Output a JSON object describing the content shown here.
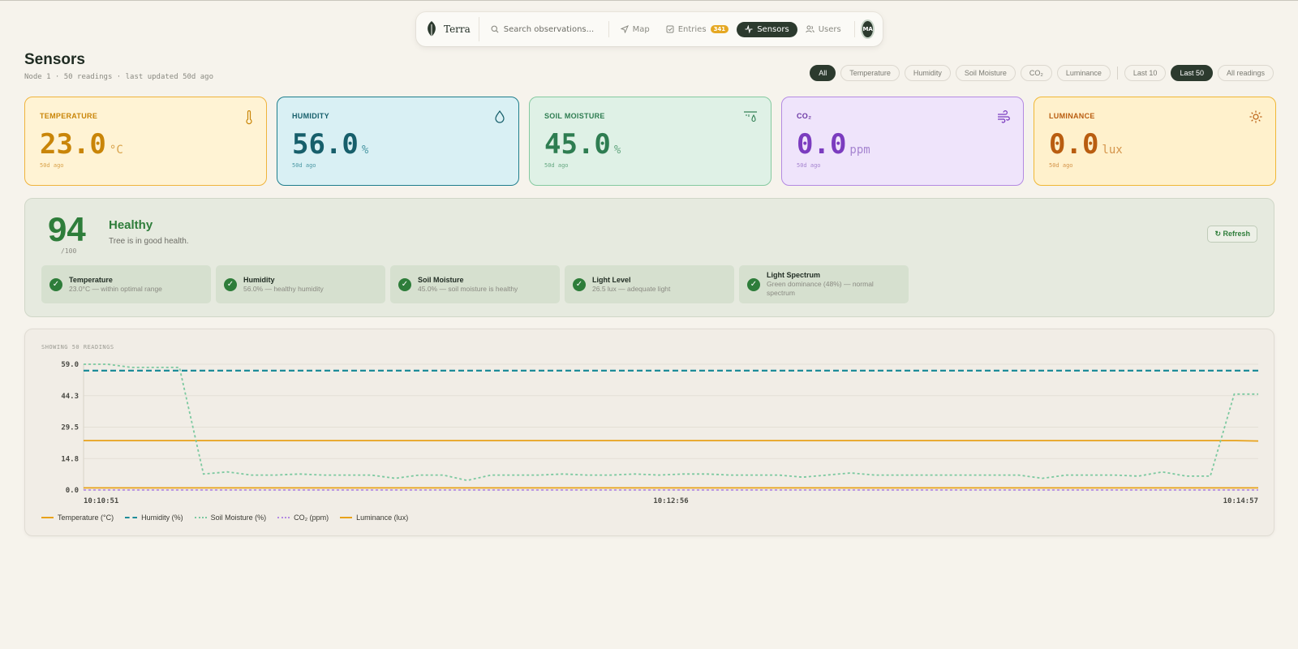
{
  "nav": {
    "brand": "Terra",
    "search_placeholder": "Search observations...",
    "items": [
      {
        "label": "Map",
        "icon": "send-icon"
      },
      {
        "label": "Entries",
        "icon": "checkbox-icon",
        "badge": "341"
      },
      {
        "label": "Sensors",
        "icon": "activity-icon",
        "active": true
      },
      {
        "label": "Users",
        "icon": "users-icon"
      }
    ],
    "avatar": "MA"
  },
  "header": {
    "title": "Sensors",
    "subtitle": "Node 1 · 50 readings · last updated 50d ago"
  },
  "filters": {
    "types": [
      "All",
      "Temperature",
      "Humidity",
      "Soil Moisture",
      "CO₂",
      "Luminance"
    ],
    "ranges": [
      "Last 10",
      "Last 50",
      "All readings"
    ],
    "active_type": "All",
    "active_range": "Last 50"
  },
  "cards": [
    {
      "label": "TEMPERATURE",
      "value": "23.0",
      "unit": "°C",
      "ago": "50d ago",
      "icon": "thermometer-icon"
    },
    {
      "label": "HUMIDITY",
      "value": "56.0",
      "unit": "%",
      "ago": "50d ago",
      "icon": "droplet-icon"
    },
    {
      "label": "SOIL MOISTURE",
      "value": "45.0",
      "unit": "%",
      "ago": "50d ago",
      "icon": "sprinkler-icon"
    },
    {
      "label": "CO₂",
      "value": "0.0",
      "unit": "ppm",
      "ago": "50d ago",
      "icon": "wind-icon"
    },
    {
      "label": "LUMINANCE",
      "value": "0.0",
      "unit": "lux",
      "ago": "50d ago",
      "icon": "sun-icon"
    }
  ],
  "health": {
    "score": "94",
    "max": "/100",
    "status": "Healthy",
    "description": "Tree is in good health.",
    "refresh_label": "↻ Refresh",
    "checks": [
      {
        "title": "Temperature",
        "desc": "23.0°C — within optimal range"
      },
      {
        "title": "Humidity",
        "desc": "56.0% — healthy humidity"
      },
      {
        "title": "Soil Moisture",
        "desc": "45.0% — soil moisture is healthy"
      },
      {
        "title": "Light Level",
        "desc": "26.5 lux — adequate light"
      },
      {
        "title": "Light Spectrum",
        "desc": "Green dominance (48%) — normal spectrum"
      }
    ]
  },
  "chart_caption": "SHOWING 50 READINGS",
  "chart_data": {
    "type": "line",
    "ylim": [
      0.0,
      59.0
    ],
    "yticks": [
      "59.0",
      "44.3",
      "29.5",
      "14.8",
      "0.0"
    ],
    "xticks": [
      "10:10:51",
      "10:12:56",
      "10:14:57"
    ],
    "grid": true,
    "legend": "bottom-left",
    "series": [
      {
        "name": "Temperature (°C)",
        "color": "#e8a21a",
        "dash": "solid",
        "values": [
          23.2,
          23.2,
          23.2,
          23.2,
          23.2,
          23.2,
          23.2,
          23.2,
          23.2,
          23.2,
          23.2,
          23.2,
          23.2,
          23.2,
          23.2,
          23.2,
          23.2,
          23.2,
          23.2,
          23.2,
          23.2,
          23.2,
          23.2,
          23.2,
          23.2,
          23.2,
          23.2,
          23.2,
          23.2,
          23.2,
          23.2,
          23.2,
          23.2,
          23.2,
          23.2,
          23.2,
          23.2,
          23.2,
          23.2,
          23.2,
          23.2,
          23.2,
          23.2,
          23.2,
          23.2,
          23.2,
          23.2,
          23.2,
          23.2,
          23.0
        ]
      },
      {
        "name": "Humidity (%)",
        "color": "#1e8c99",
        "dash": "dashed",
        "values": [
          56.0,
          56.0,
          56.0,
          56.0,
          56.0,
          56.0,
          56.0,
          56.0,
          56.0,
          56.0,
          56.0,
          56.0,
          56.0,
          56.0,
          56.0,
          56.0,
          56.0,
          56.0,
          56.0,
          56.0,
          56.0,
          56.0,
          56.0,
          56.0,
          56.0,
          56.0,
          56.0,
          56.0,
          56.0,
          56.0,
          56.0,
          56.0,
          56.0,
          56.0,
          56.0,
          56.0,
          56.0,
          56.0,
          56.0,
          56.0,
          56.0,
          56.0,
          56.0,
          56.0,
          56.0,
          56.0,
          56.0,
          56.0,
          56.0,
          56.0
        ]
      },
      {
        "name": "Soil Moisture (%)",
        "color": "#7cc9a0",
        "dash": "dotted",
        "values": [
          59.0,
          59.0,
          57.5,
          57.5,
          57.5,
          7.5,
          8.5,
          7.0,
          7.0,
          7.5,
          7.0,
          7.0,
          7.0,
          5.5,
          7.0,
          7.0,
          4.5,
          7.0,
          7.0,
          7.0,
          7.5,
          7.0,
          7.0,
          7.5,
          7.0,
          7.5,
          7.5,
          7.0,
          7.0,
          7.0,
          6.0,
          7.0,
          8.0,
          7.0,
          7.0,
          7.0,
          7.0,
          7.0,
          7.0,
          7.0,
          5.5,
          7.0,
          7.0,
          7.0,
          6.5,
          8.5,
          6.5,
          6.5,
          45.0,
          45.0
        ]
      },
      {
        "name": "CO₂ (ppm)",
        "color": "#b48ae2",
        "dash": "dotted",
        "values": [
          0,
          0,
          0,
          0,
          0,
          0,
          0,
          0,
          0,
          0,
          0,
          0,
          0,
          0,
          0,
          0,
          0,
          0,
          0,
          0,
          0,
          0,
          0,
          0,
          0,
          0,
          0,
          0,
          0,
          0,
          0,
          0,
          0,
          0,
          0,
          0,
          0,
          0,
          0,
          0,
          0,
          0,
          0,
          0,
          0,
          0,
          0,
          0,
          0,
          0
        ]
      },
      {
        "name": "Luminance (lux)",
        "color": "#e8a21a",
        "dash": "solid",
        "values": [
          1.0,
          1.0,
          1.0,
          1.0,
          1.0,
          1.0,
          1.0,
          1.0,
          1.0,
          1.0,
          1.0,
          1.0,
          1.0,
          1.0,
          1.0,
          1.0,
          1.0,
          1.0,
          1.0,
          1.0,
          1.0,
          1.0,
          1.0,
          1.0,
          1.0,
          1.0,
          1.0,
          1.0,
          1.0,
          1.0,
          1.0,
          1.0,
          1.0,
          1.0,
          1.0,
          1.0,
          1.0,
          1.0,
          1.0,
          1.0,
          1.0,
          1.0,
          1.0,
          1.0,
          1.0,
          1.0,
          1.0,
          1.0,
          1.0,
          1.0
        ]
      }
    ]
  }
}
